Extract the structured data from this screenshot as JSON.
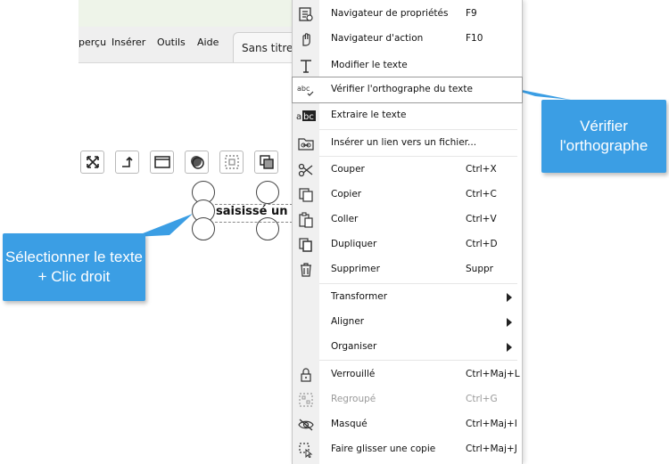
{
  "app": {
    "menubar": [
      "perçu",
      "Insérer",
      "Outils",
      "Aide"
    ],
    "document_tab": "Sans titre"
  },
  "canvas": {
    "selected_text": "saisissé un te"
  },
  "callouts": {
    "left": "Sélectionner le texte + Clic droit",
    "right": "Vérifier l'orthographe"
  },
  "context_menu": {
    "items": [
      {
        "label": "Navigateur de propriétés",
        "shortcut": "F9",
        "icon": "properties-icon"
      },
      {
        "label": "Navigateur d'action",
        "shortcut": "F10",
        "icon": "hand-icon"
      },
      {
        "label": "Modifier le texte",
        "shortcut": "",
        "icon": "text-icon"
      },
      {
        "label": "Vérifier l'orthographe du texte",
        "shortcut": "",
        "icon": "spellcheck-icon",
        "highlighted": true
      },
      {
        "label": "Extraire le texte",
        "shortcut": "",
        "icon": "extract-text-icon"
      },
      {
        "label": "Insérer un lien vers un fichier...",
        "shortcut": "",
        "icon": "link-folder-icon"
      },
      {
        "label": "Couper",
        "shortcut": "Ctrl+X",
        "icon": "scissors-icon"
      },
      {
        "label": "Copier",
        "shortcut": "Ctrl+C",
        "icon": "copy-icon"
      },
      {
        "label": "Coller",
        "shortcut": "Ctrl+V",
        "icon": "paste-icon"
      },
      {
        "label": "Dupliquer",
        "shortcut": "Ctrl+D",
        "icon": "duplicate-icon"
      },
      {
        "label": "Supprimer",
        "shortcut": "Suppr",
        "icon": "trash-icon"
      },
      {
        "label": "Transformer",
        "shortcut": "",
        "icon": "",
        "submenu": true
      },
      {
        "label": "Aligner",
        "shortcut": "",
        "icon": "",
        "submenu": true
      },
      {
        "label": "Organiser",
        "shortcut": "",
        "icon": "",
        "submenu": true
      },
      {
        "label": "Verrouillé",
        "shortcut": "Ctrl+Maj+L",
        "icon": "lock-icon"
      },
      {
        "label": "Regroupé",
        "shortcut": "Ctrl+G",
        "icon": "group-icon",
        "disabled": true
      },
      {
        "label": "Masqué",
        "shortcut": "Ctrl+Maj+I",
        "icon": "eye-hidden-icon"
      },
      {
        "label": "Faire glisser une copie",
        "shortcut": "Ctrl+Maj+J",
        "icon": "drag-copy-icon"
      }
    ]
  },
  "colors": {
    "callout": "#3b9ee4",
    "menu_gutter": "#f0f0f0"
  }
}
